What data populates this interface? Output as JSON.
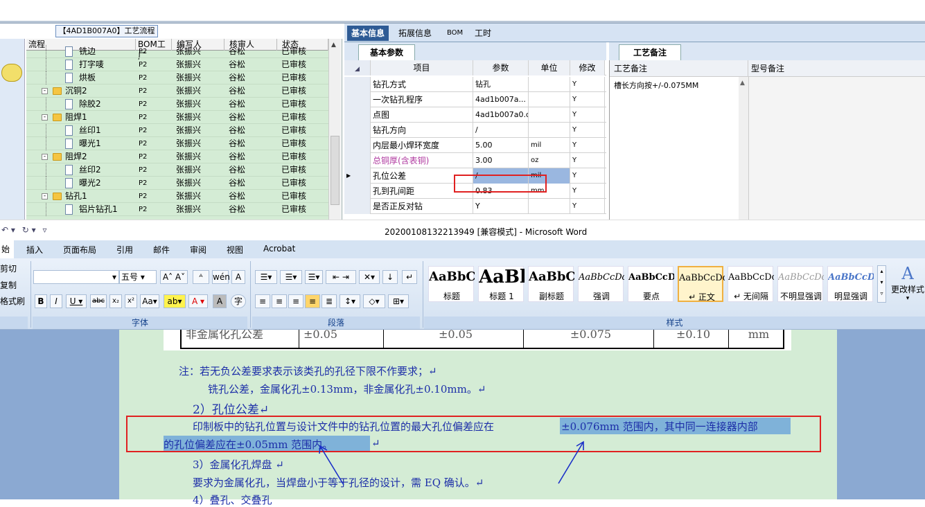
{
  "left_panel": {
    "title": "【4AD1B007A0】工艺流程",
    "columns": [
      "流程",
      "BOM工厂",
      "编写人",
      "核审人",
      "状态"
    ],
    "rows": [
      {
        "name": "铣边",
        "level": 2,
        "type": "doc",
        "factory": "P2",
        "writer": "张振兴",
        "reviewer": "谷松",
        "status": "已审核"
      },
      {
        "name": "打字唛",
        "level": 2,
        "type": "doc",
        "factory": "P2",
        "writer": "张振兴",
        "reviewer": "谷松",
        "status": "已审核"
      },
      {
        "name": "烘板",
        "level": 2,
        "type": "doc",
        "factory": "P2",
        "writer": "张振兴",
        "reviewer": "谷松",
        "status": "已审核"
      },
      {
        "name": "沉铜2",
        "level": 1,
        "type": "folder",
        "factory": "P2",
        "writer": "张振兴",
        "reviewer": "谷松",
        "status": "已审核"
      },
      {
        "name": "除胶2",
        "level": 2,
        "type": "doc",
        "factory": "P2",
        "writer": "张振兴",
        "reviewer": "谷松",
        "status": "已审核"
      },
      {
        "name": "阻焊1",
        "level": 1,
        "type": "folder",
        "factory": "P2",
        "writer": "张振兴",
        "reviewer": "谷松",
        "status": "已审核"
      },
      {
        "name": "丝印1",
        "level": 2,
        "type": "doc",
        "factory": "P2",
        "writer": "张振兴",
        "reviewer": "谷松",
        "status": "已审核"
      },
      {
        "name": "曝光1",
        "level": 2,
        "type": "doc",
        "factory": "P2",
        "writer": "张振兴",
        "reviewer": "谷松",
        "status": "已审核"
      },
      {
        "name": "阻焊2",
        "level": 1,
        "type": "folder",
        "factory": "P2",
        "writer": "张振兴",
        "reviewer": "谷松",
        "status": "已审核"
      },
      {
        "name": "丝印2",
        "level": 2,
        "type": "doc",
        "factory": "P2",
        "writer": "张振兴",
        "reviewer": "谷松",
        "status": "已审核"
      },
      {
        "name": "曝光2",
        "level": 2,
        "type": "doc",
        "factory": "P2",
        "writer": "张振兴",
        "reviewer": "谷松",
        "status": "已审核"
      },
      {
        "name": "钻孔1",
        "level": 1,
        "type": "folder",
        "factory": "P2",
        "writer": "张振兴",
        "reviewer": "谷松",
        "status": "已审核"
      },
      {
        "name": "铝片钻孔1",
        "level": 2,
        "type": "doc",
        "factory": "P2",
        "writer": "张振兴",
        "reviewer": "谷松",
        "status": "已审核"
      }
    ]
  },
  "right_tabs": [
    "基本信息",
    "拓展信息",
    "BOM",
    "工时"
  ],
  "basic_params": {
    "tab": "基本参数",
    "columns": [
      "项目",
      "参数",
      "单位",
      "修改"
    ],
    "rows": [
      {
        "item": "钻孔方式",
        "value": "钻孔",
        "unit": "",
        "edit": "Y"
      },
      {
        "item": "一次钻孔程序",
        "value": "4ad1b007a...",
        "unit": "",
        "edit": "Y"
      },
      {
        "item": "点图",
        "value": "4ad1b007a0.d",
        "unit": "",
        "edit": "Y"
      },
      {
        "item": "钻孔方向",
        "value": "/",
        "unit": "",
        "edit": "Y"
      },
      {
        "item": "内层最小焊环宽度",
        "value": "5.00",
        "unit": "mil",
        "edit": "Y"
      },
      {
        "item": "总铜厚(含表铜)",
        "value": "3.00",
        "unit": "oz",
        "edit": "Y",
        "highlight": true
      },
      {
        "item": "孔位公差",
        "value": "/",
        "unit": "mil",
        "edit": "Y",
        "current": true
      },
      {
        "item": "孔到孔间距",
        "value": "0.83",
        "unit": "mm",
        "edit": "Y"
      },
      {
        "item": "是否正反对钻",
        "value": "Y",
        "unit": "",
        "edit": "Y"
      }
    ]
  },
  "notes": {
    "tab": "工艺备注",
    "col1": "工艺备注",
    "col2": "型号备注",
    "text": "槽长方向按+/-0.075MM"
  },
  "word": {
    "title": "20200108132213949 [兼容模式] - Microsoft Word",
    "tabs": [
      "始",
      "插入",
      "页面布局",
      "引用",
      "邮件",
      "审阅",
      "视图",
      "Acrobat"
    ],
    "clipboard": [
      "剪切",
      "复制",
      "格式刷"
    ],
    "font_size": "五号",
    "group_font": "字体",
    "group_para": "段落",
    "group_styles": "样式",
    "change_styles": "更改样式",
    "styles": [
      {
        "sample": "AaBbC",
        "name": "标题"
      },
      {
        "sample": "AaBl",
        "name": "标题 1"
      },
      {
        "sample": "AaBbC",
        "name": "副标题"
      },
      {
        "sample": "AaBbCcDd",
        "name": "强调"
      },
      {
        "sample": "AaBbCcD",
        "name": "要点"
      },
      {
        "sample": "AaBbCcDd",
        "name": "↵ 正文"
      },
      {
        "sample": "AaBbCcDd",
        "name": "↵ 无间隔"
      },
      {
        "sample": "AaBbCcDd",
        "name": "不明显强调"
      },
      {
        "sample": "AaBbCcDd",
        "name": "明显强调"
      }
    ]
  },
  "document": {
    "table_cells": [
      "非金属化孔公差",
      "±0.05",
      "±0.05",
      "±0.075",
      "±0.10",
      "mm"
    ],
    "note1": "注：若无负公差要求表示该类孔的孔径下限不作要求；↵",
    "note2": "铣孔公差，金属化孔±0.13mm，非金属化孔±0.10mm。↵",
    "heading2": "2）孔位公差↵",
    "para_a": "印制板中的钻孔位置与设计文件中的钻孔位置的最大孔位偏差应在",
    "para_b": "±0.076mm  范围内，其中同一连接器内部",
    "para_c": "的孔位偏差应在±0.05mm  范围内。",
    "para_c_end": "↵",
    "heading3": "3）金属化孔焊盘 ↵",
    "para2": "要求为金属化孔，当焊盘小于等于孔径的设计，需 EQ 确认。↵",
    "heading4": "4）叠孔、交叠孔"
  }
}
